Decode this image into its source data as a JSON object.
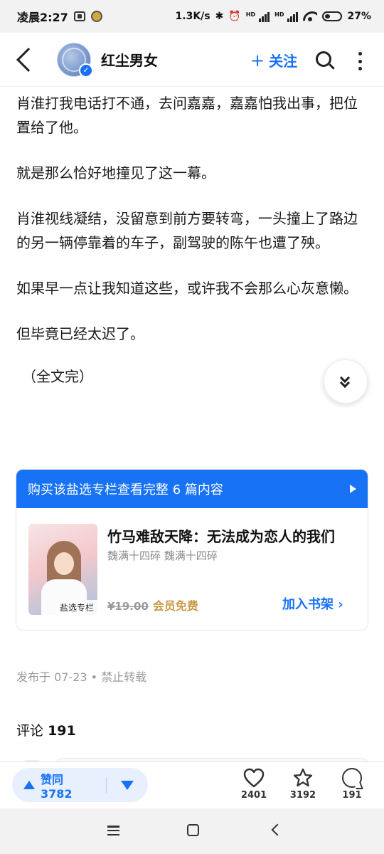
{
  "status_bar": {
    "time": "凌晨2:27",
    "net_speed": "1.3K/s",
    "signal_tag_1": "HD",
    "signal_tag_2": "HD",
    "battery": "27%"
  },
  "header": {
    "author_name": "红尘男女",
    "follow_label": "关注",
    "follow_icon": "plus-icon",
    "accent_color": "#1772f6"
  },
  "article": {
    "paragraphs": [
      "肖淮打我电话打不通，去问嘉嘉，嘉嘉怕我出事，把位置给了他。",
      "就是那么恰好地撞见了这一幕。",
      "肖淮视线凝结，没留意到前方要转弯，一头撞上了路边的另一辆停靠着的车子，副驾驶的陈午也遭了殃。",
      "如果早一点让我知道这些，或许我不会那么心灰意懒。",
      "但毕竟已经太迟了。"
    ],
    "ending": "（全文完）"
  },
  "paid_card": {
    "banner": "购买该盐选专栏查看完整 6 篇内容",
    "cover_tag": "盐选专栏",
    "book_title": "竹马难敌天降：无法成为恋人的我们",
    "book_author": "魏满十四碎 魏满十四碎",
    "old_price": "¥19.00",
    "vip_label": "会员免费",
    "shelf_label": "加入书架 ›"
  },
  "meta": {
    "published": "发布于 07-23 • 禁止转载"
  },
  "comments": {
    "label": "评论",
    "count": "191"
  },
  "action_bar": {
    "upvote_label": "赞同 3782",
    "likes": "2401",
    "favorites": "3192",
    "comments": "191"
  }
}
